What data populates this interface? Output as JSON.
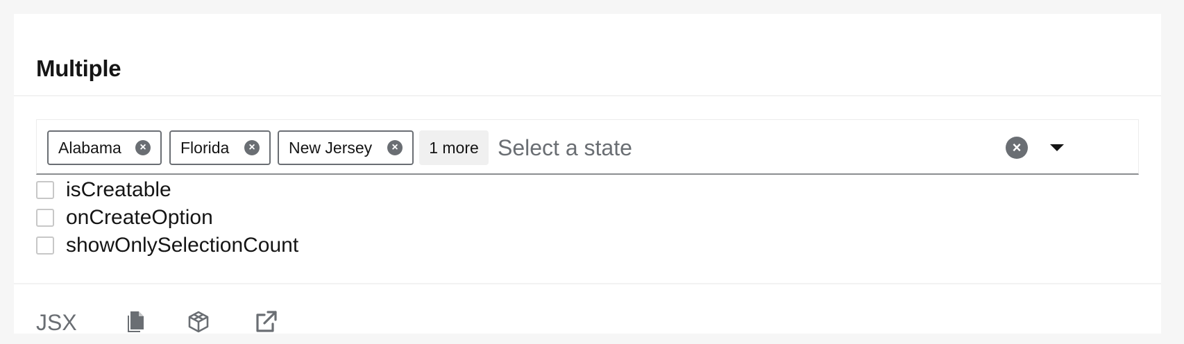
{
  "card": {
    "title": "Multiple"
  },
  "select": {
    "chips": [
      {
        "label": "Alabama",
        "remove_icon": "close-circle-icon"
      },
      {
        "label": "Florida",
        "remove_icon": "close-circle-icon"
      },
      {
        "label": "New Jersey",
        "remove_icon": "close-circle-icon"
      }
    ],
    "more_label": "1 more",
    "input_placeholder": "Select a state",
    "input_value": "",
    "clear_icon": "close-circle-icon",
    "toggle_icon": "caret-down-icon"
  },
  "options": [
    {
      "label": "isCreatable",
      "checked": false
    },
    {
      "label": "onCreateOption",
      "checked": false
    },
    {
      "label": "showOnlySelectionCount",
      "checked": false
    }
  ],
  "toolbar": {
    "language_label": "JSX",
    "icons": [
      "copy-icon",
      "codesandbox-icon",
      "external-link-icon"
    ]
  },
  "colors": {
    "chip_border": "#6a6e73",
    "more_chip_bg": "#f0f0f0",
    "input_underline": "#8a8d90",
    "muted_text": "#6a6e73"
  }
}
